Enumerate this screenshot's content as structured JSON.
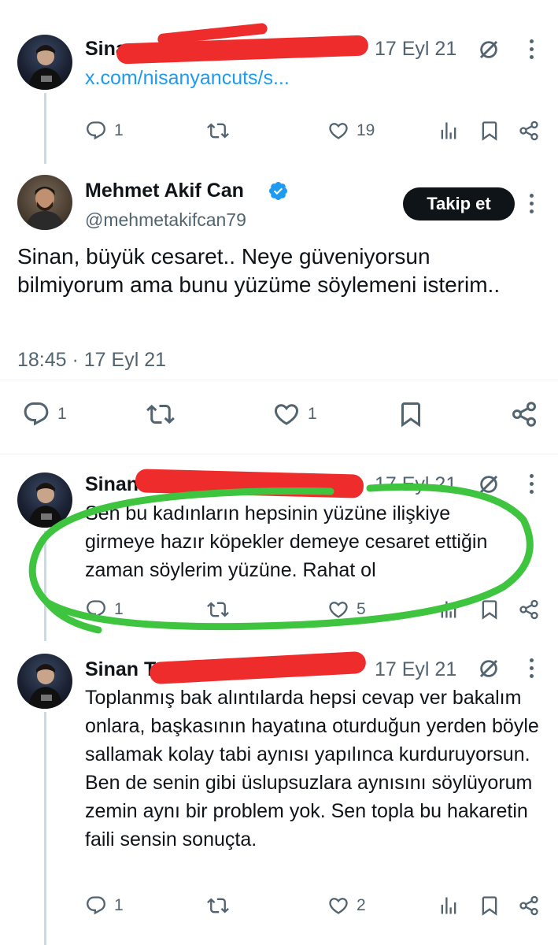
{
  "tweets": [
    {
      "author_visible": "Sina",
      "date": "17 Eyl 21",
      "link_text": "x.com/nisanyancuts/s...",
      "replies": "1",
      "likes": "19"
    },
    {
      "author": "Mehmet Akif Can",
      "handle": "@mehmetakifcan79",
      "follow_label": "Takip et",
      "text": "Sinan, büyük cesaret.. Neye güveniyorsun bilmiyorum ama bunu yüzüme söylemeni isterim..",
      "timestamp": "18:45 · 17 Eyl 21",
      "replies": "1",
      "likes": "1"
    },
    {
      "author_visible": "Sinan",
      "date": "17 Eyl 21",
      "text": "Sen bu kadınların hepsinin yüzüne ilişkiye girmeye hazır köpekler demeye cesaret ettiğin zaman söylerim yüzüne. Rahat ol",
      "replies": "1",
      "likes": "5"
    },
    {
      "author_visible": "Sinan T",
      "date": "17 Eyl 21",
      "text": "Toplanmış bak alıntılarda hepsi cevap ver bakalım onlara, başkasının hayatına oturduğun yerden böyle sallamak kolay tabi aynısı yapılınca kurduruyorsun. Ben de senin gibi üslupsuzlara aynısını söylüyorum zemin aynı bir problem yok. Sen topla bu hakaretin faili sensin sonuçta.",
      "replies": "1",
      "likes": "2"
    }
  ],
  "colors": {
    "text": "#0f1419",
    "muted": "#536471",
    "link": "#1d9bf0",
    "verified": "#1d9bf0",
    "redaction": "#ee2c2c",
    "annotation_circle": "#3ec43e"
  },
  "icons": [
    "reply-icon",
    "retweet-icon",
    "like-icon",
    "views-icon",
    "bookmark-icon",
    "share-icon",
    "grok-icon",
    "verified-badge-icon",
    "more-icon"
  ]
}
